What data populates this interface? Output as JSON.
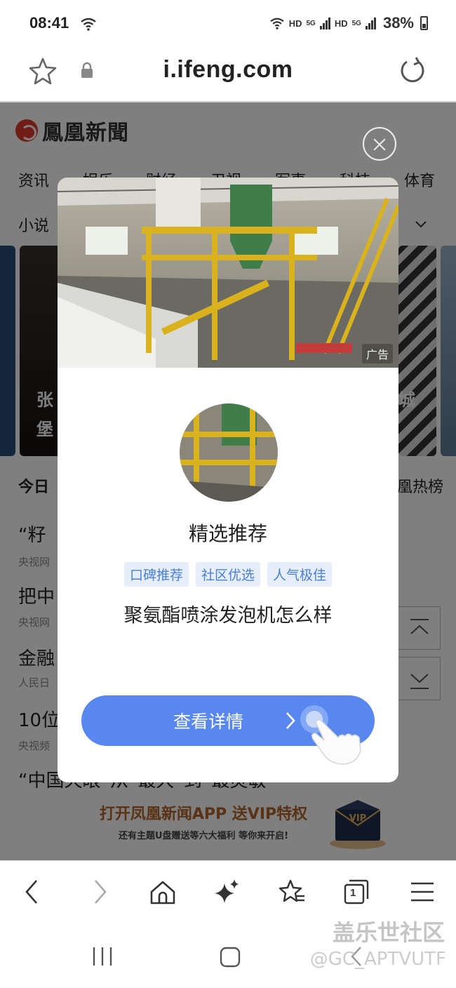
{
  "status_bar": {
    "time": "08:41",
    "hd1": "HD",
    "g1": "5G",
    "hd2": "HD",
    "g2": "5G",
    "battery": "38%"
  },
  "browser": {
    "url": "i.ifeng.com",
    "icons": [
      "star-icon",
      "lock-icon",
      "reload-icon"
    ]
  },
  "page": {
    "logo_text": "鳳凰新聞",
    "nav_tabs": [
      "资讯",
      "娱乐",
      "财经",
      "卫视",
      "军事",
      "科技",
      "体育"
    ],
    "nav_row2_first": "小说",
    "hero_captions": [
      "张",
      "堡",
      "城"
    ],
    "hot_title": "今日",
    "hot_rank_label": "凰热榜",
    "news": [
      {
        "title": "“籽",
        "source": "央视网"
      },
      {
        "title": "把中",
        "source": "央视网"
      },
      {
        "title": "金融",
        "source": "人民日"
      },
      {
        "title": "10位",
        "source": "央视频"
      },
      {
        "title": "“中国天眼”从“最大”到“最灵敏",
        "source": ""
      }
    ],
    "promo_main": "打开凤凰新闻APP 送VIP特权",
    "promo_sub": "还有主题U盘赠送等六大福利  等你来开启!",
    "promo_vip": "VIP"
  },
  "ad_modal": {
    "ad_badge": "广告",
    "title": "精选推荐",
    "tags": [
      "口碑推荐",
      "社区优选",
      "人气极佳"
    ],
    "description": "聚氨酯喷涂发泡机怎么样",
    "cta_label": "查看详情",
    "accent_color": "#5888ef"
  },
  "toolbar": {
    "icons": [
      "back-icon",
      "forward-icon",
      "home-icon",
      "ai-sparkle-icon",
      "bookmarks-icon",
      "tabs-icon",
      "menu-icon"
    ],
    "tab_count": "1"
  },
  "watermark": {
    "brand": "盖乐世社区",
    "handle": "@GC_APTVUTF"
  }
}
